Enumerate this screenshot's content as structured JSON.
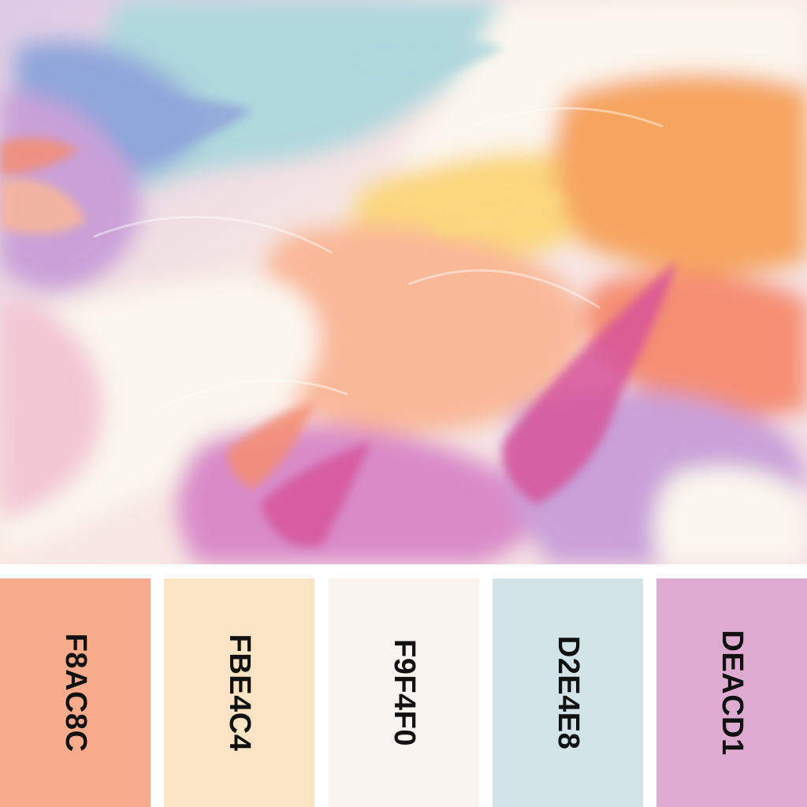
{
  "artwork": {
    "icon": "abstract-watercolor-swirl",
    "colors": {
      "base": "#F7EEEE",
      "cream": "#FBF6EE",
      "sky": "#AFD8DD",
      "periwinkle": "#8FA6DA",
      "lavender": "#C9A0D8",
      "orchid": "#D98BC8",
      "magenta": "#D6549A",
      "peach": "#F9B898",
      "coral": "#F58E73",
      "apricot": "#F6A560",
      "butter": "#FBD77E",
      "blush": "#F3C6D4"
    }
  },
  "palette": {
    "swatches": [
      {
        "hex_label": "F8AC8C",
        "color": "#F8AC8C"
      },
      {
        "hex_label": "FBE4C4",
        "color": "#FBE4C4"
      },
      {
        "hex_label": "F9F4F0",
        "color": "#F9F4F0"
      },
      {
        "hex_label": "D2E4E8",
        "color": "#D2E4E8"
      },
      {
        "hex_label": "DEACD1",
        "color": "#DEACD1"
      }
    ]
  }
}
